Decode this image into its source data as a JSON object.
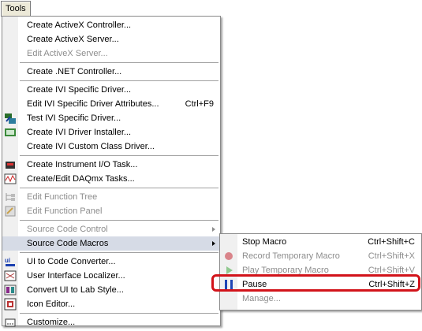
{
  "menubar": {
    "tools_label": "Tools"
  },
  "tools_menu": {
    "items": [
      {
        "label": "Create ActiveX Controller...",
        "shortcut": ""
      },
      {
        "label": "Create ActiveX Server...",
        "shortcut": ""
      },
      {
        "label": "Edit ActiveX Server...",
        "shortcut": ""
      },
      {
        "label": "Create .NET Controller...",
        "shortcut": ""
      },
      {
        "label": "Create IVI Specific Driver...",
        "shortcut": ""
      },
      {
        "label": "Edit IVI Specific Driver Attributes...",
        "shortcut": "Ctrl+F9"
      },
      {
        "label": "Test IVI Specific Driver...",
        "shortcut": ""
      },
      {
        "label": "Create IVI Driver Installer...",
        "shortcut": ""
      },
      {
        "label": "Create IVI Custom Class Driver...",
        "shortcut": ""
      },
      {
        "label": "Create Instrument I/O Task...",
        "shortcut": ""
      },
      {
        "label": "Create/Edit DAQmx Tasks...",
        "shortcut": ""
      },
      {
        "label": "Edit Function Tree",
        "shortcut": ""
      },
      {
        "label": "Edit Function Panel",
        "shortcut": ""
      },
      {
        "label": "Source Code Control",
        "shortcut": ""
      },
      {
        "label": "Source Code Macros",
        "shortcut": ""
      },
      {
        "label": "UI to Code Converter...",
        "shortcut": ""
      },
      {
        "label": "User Interface Localizer...",
        "shortcut": ""
      },
      {
        "label": "Convert UI to Lab Style...",
        "shortcut": ""
      },
      {
        "label": "Icon Editor...",
        "shortcut": ""
      },
      {
        "label": "Customize...",
        "shortcut": ""
      }
    ]
  },
  "macros_submenu": {
    "items": [
      {
        "label": "Stop Macro",
        "shortcut": "Ctrl+Shift+C"
      },
      {
        "label": "Record Temporary Macro",
        "shortcut": "Ctrl+Shift+X"
      },
      {
        "label": "Play Temporary Macro",
        "shortcut": "Ctrl+Shift+V"
      },
      {
        "label": "Pause",
        "shortcut": "Ctrl+Shift+Z"
      },
      {
        "label": "Manage...",
        "shortcut": ""
      }
    ]
  },
  "colors": {
    "highlight": "#d6dbe6",
    "callout": "#d2131a",
    "disabled": "#8d8d8d"
  },
  "icons": [
    "activex-icon",
    "ivi-icon",
    "io-task-icon",
    "daqmx-icon",
    "function-tree-icon",
    "function-panel-icon",
    "ui-converter-icon",
    "localizer-icon",
    "convert-ui-icon",
    "icon-editor-icon",
    "customize-icon",
    "record-icon",
    "play-icon",
    "pause-icon"
  ]
}
